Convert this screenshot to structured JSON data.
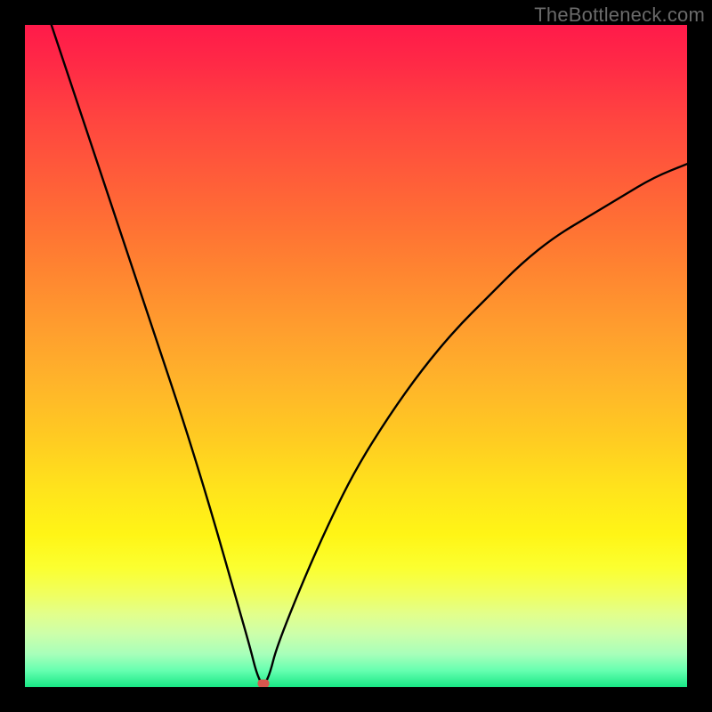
{
  "watermark": "TheBottleneck.com",
  "colors": {
    "frame": "#000000",
    "curve": "#000000",
    "marker": "#d6574e"
  },
  "chart_data": {
    "type": "line",
    "title": "",
    "xlabel": "",
    "ylabel": "",
    "xlim": [
      0,
      100
    ],
    "ylim": [
      0,
      100
    ],
    "grid": false,
    "legend": false,
    "note": "Axes unlabeled; x in 0–100 (left→right), y in 0–100 (bottom→top). Values estimated from plot.",
    "series": [
      {
        "name": "curve",
        "x": [
          4,
          8,
          12,
          16,
          20,
          24,
          28,
          32,
          34,
          35,
          36,
          37,
          38,
          42,
          46,
          50,
          55,
          60,
          65,
          70,
          75,
          80,
          85,
          90,
          95,
          100
        ],
        "y": [
          100,
          88,
          76,
          64,
          52,
          40,
          27,
          13,
          6,
          2,
          0,
          2,
          6,
          16,
          25,
          33,
          41,
          48,
          54,
          59,
          64,
          68,
          71,
          74,
          77,
          79
        ]
      }
    ],
    "marker": {
      "x": 36,
      "y": 0.6
    },
    "background_gradient": {
      "top": "#ff1a4a",
      "mid": "#ffe31c",
      "bottom": "#18e885"
    }
  }
}
